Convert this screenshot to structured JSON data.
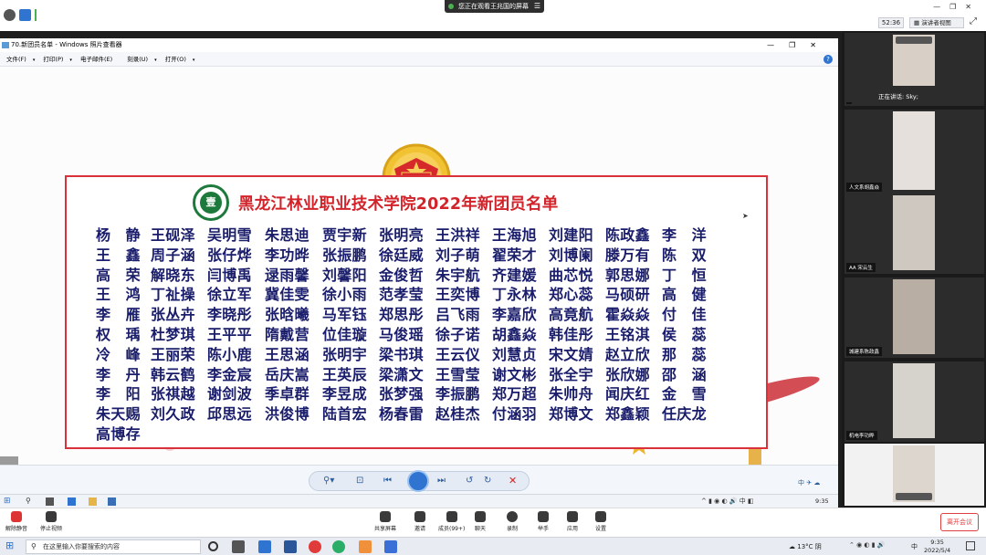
{
  "meeting": {
    "share_banner": "您正在观看王兆国的屏幕",
    "time_badge": "52:36",
    "view_mode": "演讲者视图",
    "speaking_label": "正在讲话: Sky;"
  },
  "viewer": {
    "title": "70.新团员名单 - Windows 照片查看器",
    "menu": [
      "文件(F)",
      "打印(P)",
      "电子邮件(E)",
      "刻录(U)",
      "打开(O)"
    ]
  },
  "poster": {
    "title": "黑龙江林业职业技术学院2022年新团员名单",
    "rows": [
      [
        "杨　静",
        "王砚泽",
        "吴明雪",
        "朱思迪",
        "贾宇新",
        "张明亮",
        "王洪祥",
        "王海旭",
        "刘建阳",
        "陈政鑫",
        "李　洋"
      ],
      [
        "王　鑫",
        "周子涵",
        "张仔烨",
        "李功晔",
        "张振鹏",
        "徐廷威",
        "刘子萌",
        "翟荣才",
        "刘博阑",
        "滕万有",
        "陈　双"
      ],
      [
        "高　荣",
        "解晓东",
        "闫博禹",
        "逯雨馨",
        "刘馨阳",
        "金俊哲",
        "朱宇航",
        "齐建媛",
        "曲芯悦",
        "郭思娜",
        "丁　恒"
      ],
      [
        "王　鸿",
        "丁祉操",
        "徐立军",
        "冀佳雯",
        "徐小雨",
        "范孝莹",
        "王奕博",
        "丁永林",
        "郑心蕊",
        "马硕研",
        "高　健"
      ],
      [
        "李　雁",
        "张丛卉",
        "李晓彤",
        "张晗曦",
        "马军钰",
        "郑思彤",
        "吕飞雨",
        "李嘉欣",
        "高竟航",
        "霍焱焱",
        "付　佳"
      ],
      [
        "权　瑀",
        "杜梦琪",
        "王平平",
        "隋戴营",
        "位佳璇",
        "马俊瑶",
        "徐子诺",
        "胡鑫焱",
        "韩佳彤",
        "王铭淇",
        "侯　蕊"
      ],
      [
        "冷　峰",
        "王丽荣",
        "陈小鹿",
        "王思涵",
        "张明宇",
        "梁书琪",
        "王云仪",
        "刘慧贞",
        "宋文婧",
        "赵立欣",
        "那　蕊"
      ],
      [
        "李　丹",
        "韩云鹤",
        "李金宸",
        "岳庆嵩",
        "王英辰",
        "梁潇文",
        "王雪莹",
        "谢文彬",
        "张全宇",
        "张欣娜",
        "邵　涵"
      ],
      [
        "李　阳",
        "张祺越",
        "谢剑波",
        "季卓群",
        "李昱成",
        "张梦强",
        "李振鹏",
        "郑万超",
        "朱帅舟",
        "闻庆红",
        "金　雪"
      ],
      [
        "朱天赐",
        "刘久政",
        "邱思远",
        "洪俊博",
        "陆首宏",
        "杨春雷",
        "赵桂杰",
        "付涵羽",
        "郑博文",
        "郑鑫颖",
        "任庆龙"
      ],
      [
        "高博存"
      ]
    ]
  },
  "participants": [
    {
      "name": "",
      "face_color": "#d9d0c6"
    },
    {
      "name": "人文系胡鑫焱",
      "face_color": "#e6e0dc"
    },
    {
      "name": "AA 宋云生",
      "face_color": "#cfc8c0"
    },
    {
      "name": "城建系陈政鑫",
      "face_color": "#b9aea4"
    },
    {
      "name": "机电李功晔",
      "face_color": "#d6d2cc"
    }
  ],
  "meeting_toolbar": {
    "items": [
      "解除静音",
      "停止视频",
      "共享屏幕",
      "邀请",
      "成员(99+)",
      "聊天",
      "录制",
      "举手",
      "应用",
      "设置"
    ],
    "leave": "离开会议"
  },
  "taskbar": {
    "search_placeholder": "在这里输入你要搜索的内容",
    "temperature": "13°C 阴",
    "time": "9:35",
    "date": "2022/5/4",
    "ime": "中"
  },
  "remote_taskbar": {
    "time": "9:35"
  },
  "colors": {
    "poster_border": "#d9323b",
    "title_red": "#d2232a",
    "name_blue": "#1a1d6b",
    "leave_red": "#e04040"
  }
}
